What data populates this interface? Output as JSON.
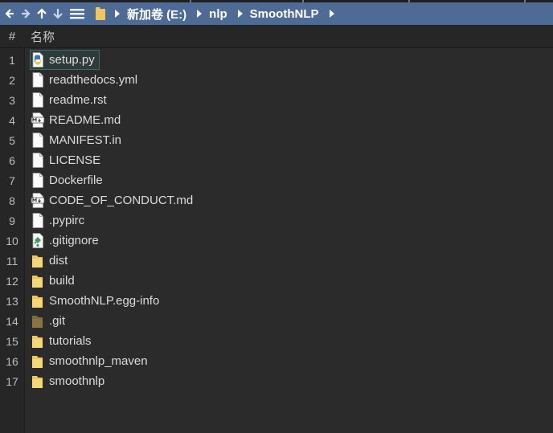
{
  "toolbar": {
    "back_icon": "arrow-left-icon",
    "forward_icon": "arrow-right-icon",
    "up_icon": "arrow-up-icon",
    "down_icon": "arrow-down-icon",
    "menu_icon": "hamburger-menu-icon",
    "breadcrumb": [
      "新加卷 (E:)",
      "nlp",
      "SmoothNLP"
    ]
  },
  "columns": {
    "index": "#",
    "name": "名称"
  },
  "files": [
    {
      "num": "1",
      "name": "setup.py",
      "icon": "python-file"
    },
    {
      "num": "2",
      "name": "readthedocs.yml",
      "icon": "blank-file"
    },
    {
      "num": "3",
      "name": "readme.rst",
      "icon": "blank-file"
    },
    {
      "num": "4",
      "name": "README.md",
      "icon": "markdown-file"
    },
    {
      "num": "5",
      "name": "MANIFEST.in",
      "icon": "blank-file"
    },
    {
      "num": "6",
      "name": "LICENSE",
      "icon": "blank-file"
    },
    {
      "num": "7",
      "name": "Dockerfile",
      "icon": "blank-file"
    },
    {
      "num": "8",
      "name": "CODE_OF_CONDUCT.md",
      "icon": "markdown-file"
    },
    {
      "num": "9",
      "name": ".pypirc",
      "icon": "blank-file"
    },
    {
      "num": "10",
      "name": ".gitignore",
      "icon": "gitignore-file"
    },
    {
      "num": "11",
      "name": "dist",
      "icon": "folder"
    },
    {
      "num": "12",
      "name": "build",
      "icon": "folder"
    },
    {
      "num": "13",
      "name": "SmoothNLP.egg-info",
      "icon": "folder"
    },
    {
      "num": "14",
      "name": ".git",
      "icon": "folder-hidden"
    },
    {
      "num": "15",
      "name": "tutorials",
      "icon": "folder"
    },
    {
      "num": "16",
      "name": "smoothnlp_maven",
      "icon": "folder"
    },
    {
      "num": "17",
      "name": "smoothnlp",
      "icon": "folder"
    }
  ],
  "selected_index": 0,
  "colors": {
    "toolbar": "#4e6b95",
    "background": "#2b2b2b",
    "folder": "#f0c55a",
    "folder_hidden": "#8a7440"
  }
}
